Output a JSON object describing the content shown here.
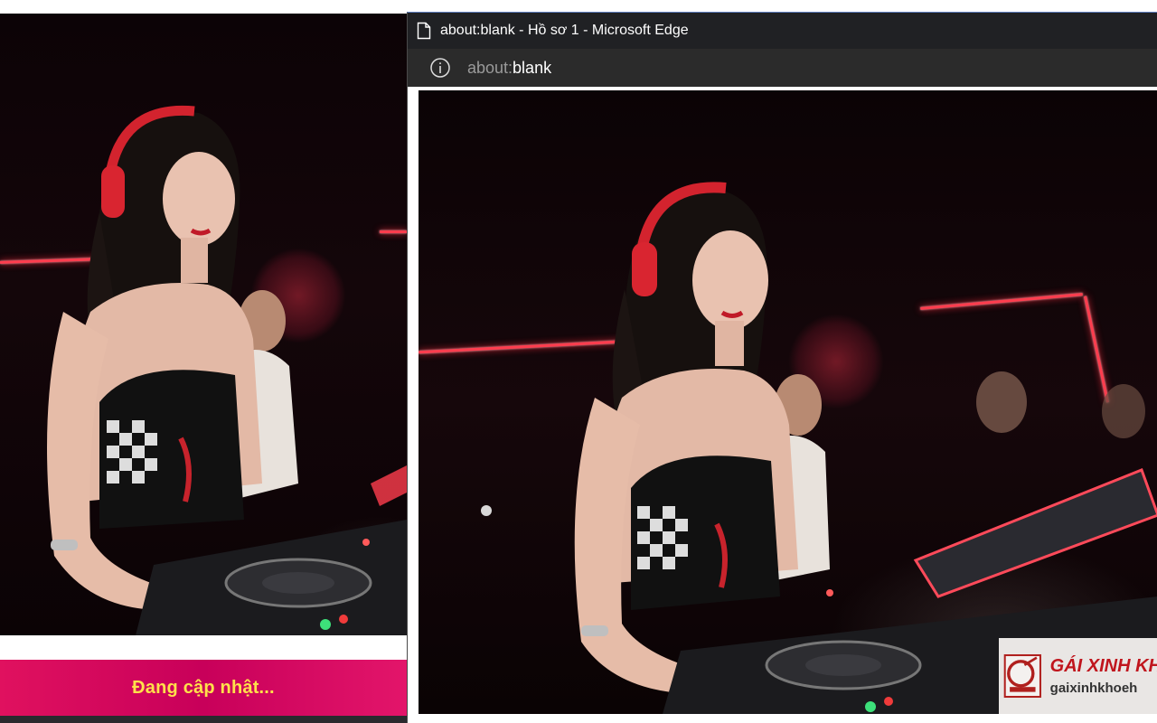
{
  "left_page": {
    "photo_alt": "Female DJ with red headphones at a nightclub mixer",
    "caption": "Đang cập nhật...",
    "accent_color": "#e0115f",
    "caption_color": "#ffe14a"
  },
  "edge_window": {
    "title": "about:blank - Hồ sơ 1 - Microsoft Edge",
    "address": {
      "prefix": "about:",
      "suffix": "blank"
    },
    "icons": {
      "title": "page-icon",
      "address": "info-icon"
    }
  },
  "watermark": {
    "title": "GÁI XINH KH",
    "url": "gaixinhkhoeh"
  }
}
